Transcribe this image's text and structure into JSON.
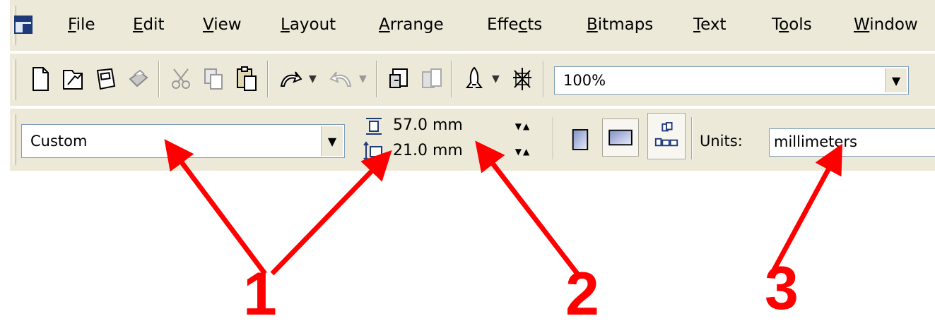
{
  "menubar": {
    "items": [
      {
        "label": "File",
        "key": "F",
        "rest": "ile"
      },
      {
        "label": "Edit",
        "key": "E",
        "rest": "dit"
      },
      {
        "label": "View",
        "key": "V",
        "rest": "iew"
      },
      {
        "label": "Layout",
        "key": "L",
        "rest": "ayout"
      },
      {
        "label": "Arrange",
        "key": "A",
        "rest": "rrange"
      },
      {
        "label": "Effects",
        "pre": "Effe",
        "key": "c",
        "rest": "ts"
      },
      {
        "label": "Bitmaps",
        "key": "B",
        "rest": "itmaps"
      },
      {
        "label": "Text",
        "key": "T",
        "rest": "ext"
      },
      {
        "label": "Tools",
        "pre": "T",
        "key": "o",
        "rest": "ols"
      },
      {
        "label": "Window",
        "key": "W",
        "rest": "indow"
      }
    ]
  },
  "toolbar": {
    "zoom_value": "100%",
    "icons": [
      "new-icon",
      "open-icon",
      "save-icon",
      "print-icon",
      "cut-icon",
      "copy-icon",
      "paste-icon",
      "undo-icon",
      "redo-icon",
      "import-icon",
      "export-icon",
      "application-launcher-icon",
      "corel-online-icon"
    ]
  },
  "propbar": {
    "paper_type": "Custom",
    "width_value": "57.0 mm",
    "height_value": "21.0 mm",
    "units_label": "Units:",
    "units_value": "millimeters"
  },
  "callouts": {
    "one": "1",
    "two": "2",
    "three": "3"
  },
  "colors": {
    "toolbar_bg": "#ece9d8",
    "annotation": "#ff0000",
    "field_border": "#7f9db9"
  }
}
